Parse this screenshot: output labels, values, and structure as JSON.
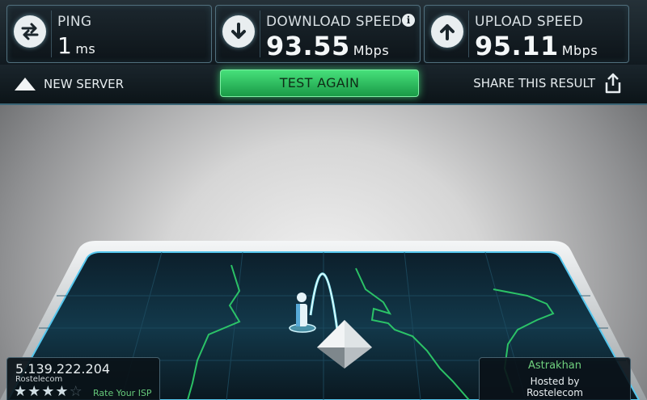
{
  "stats": {
    "ping": {
      "title": "PING",
      "value": "1",
      "unit": "ms"
    },
    "download": {
      "title": "DOWNLOAD SPEED",
      "value": "93.55",
      "unit": "Mbps",
      "info": "i"
    },
    "upload": {
      "title": "UPLOAD SPEED",
      "value": "95.11",
      "unit": "Mbps"
    }
  },
  "actions": {
    "new_server": "NEW SERVER",
    "test_again": "TEST AGAIN",
    "share": "SHARE THIS RESULT"
  },
  "client": {
    "ip": "5.139.222.204",
    "isp": "Rostelecom",
    "rating": 4,
    "rating_max": 5,
    "rate_label": "Rate Your ISP"
  },
  "server": {
    "city": "Astrakhan",
    "hosted_label": "Hosted by",
    "isp": "Rostelecom"
  },
  "colors": {
    "accent_green": "#3ddc74",
    "map_line": "#2fd36b",
    "arc_glow": "#8ff2ff"
  }
}
